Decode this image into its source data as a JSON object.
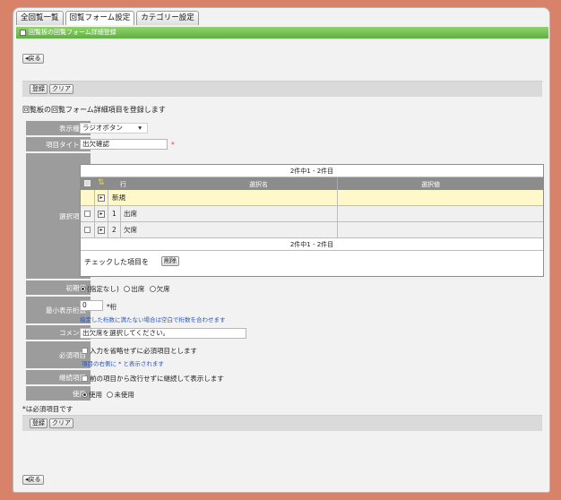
{
  "tabs": [
    "全回覧一覧",
    "回覧フォーム設定",
    "カテゴリー設定"
  ],
  "subheader": "回覧板の回覧フォーム詳細登録",
  "back_label": "◂戻る",
  "toolbar": {
    "register": "登録",
    "clear": "クリア"
  },
  "description": "回覧板の回覧フォーム詳細項目を登録します",
  "labels": {
    "display_type": "表示種類",
    "item_title": "項目タイトル",
    "choices": "選択項目",
    "initial": "初期値",
    "min_digits": "最小表示桁数",
    "comment": "コメント",
    "required": "必須項目",
    "continuous": "継続項目",
    "usage": "使用"
  },
  "display_type": {
    "value": "ラジオボタン",
    "arrow": "▾"
  },
  "item_title": {
    "value": "出欠確認",
    "req_mark": "*"
  },
  "choices_table": {
    "count_top": "2件中1 - 2件目",
    "count_bottom": "2件中1 - 2件目",
    "col_order": "行",
    "col_name": "選択名",
    "col_value": "選択値",
    "new_label": "新規",
    "rows": [
      {
        "order": "1",
        "name": "出席"
      },
      {
        "order": "2",
        "name": "欠席"
      }
    ],
    "footer_text": "チェックした項目を",
    "delete_label": "削除"
  },
  "initial": {
    "options": [
      "(指定なし)",
      "出席",
      "欠席"
    ]
  },
  "min_digits": {
    "value": "0",
    "unit": "*桁",
    "hint": "指定した桁数に満たない場合は空白で桁数を合わせます"
  },
  "comment": {
    "value": "出欠席を選択してください。"
  },
  "required": {
    "text": "入力を省略せずに必須項目とします",
    "hint": "項目の右側に * と表示されます"
  },
  "continuous": {
    "text": "前の項目から改行せずに継続して表示します"
  },
  "usage": {
    "options": [
      "使用",
      "未使用"
    ]
  },
  "footnote": "*は必須項目です"
}
